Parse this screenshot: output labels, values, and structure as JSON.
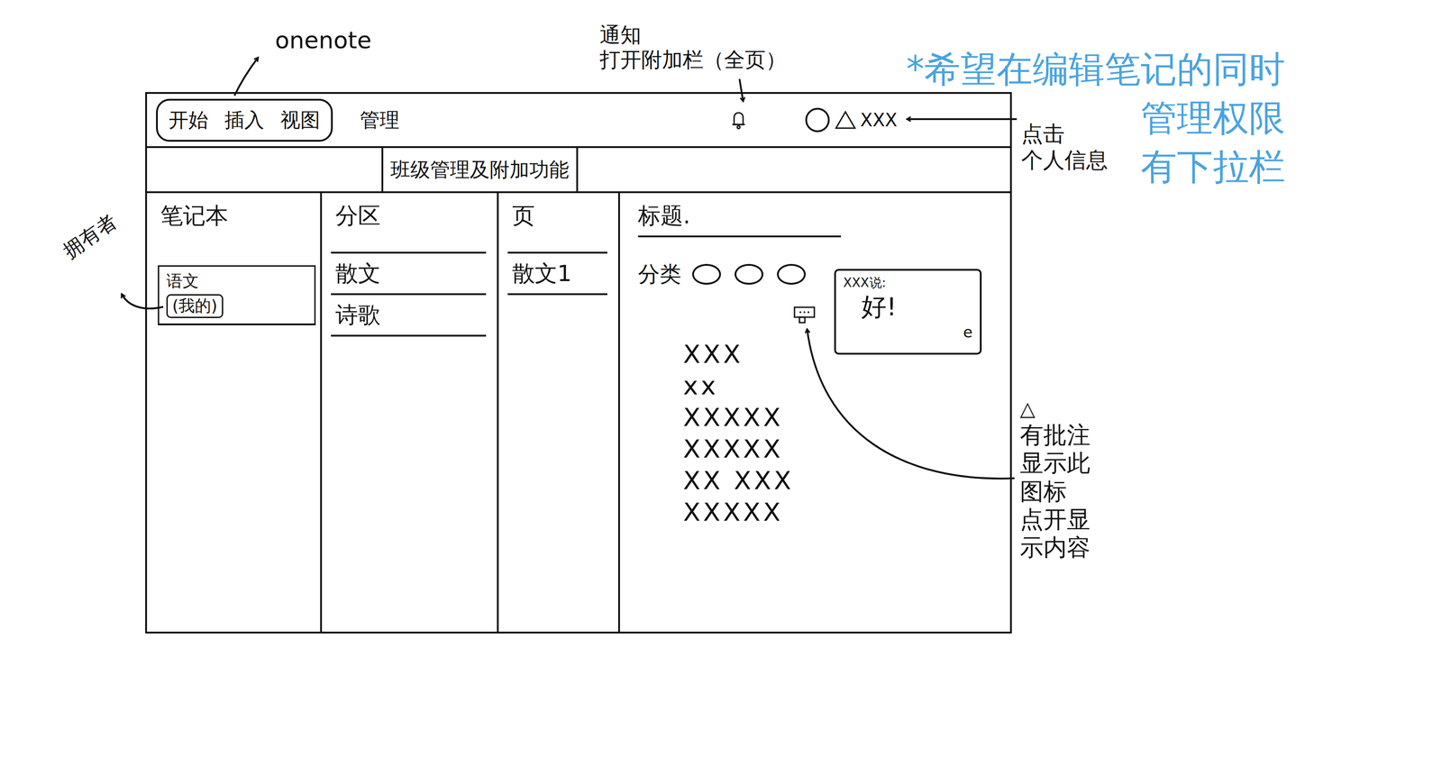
{
  "app_label": "onenote",
  "menu": [
    {
      "label": "开始",
      "grouped": true
    },
    {
      "label": "插入",
      "grouped": true
    },
    {
      "label": "视图",
      "grouped": true
    },
    {
      "label": "管理",
      "grouped": false
    }
  ],
  "sub_bar": "班级管理及附加功能",
  "notification_note": {
    "title": "通知",
    "text": "打开附加栏（全页）"
  },
  "user": {
    "name": "XXX"
  },
  "user_note": [
    "点击",
    "个人信息"
  ],
  "wish_note": [
    "*希望在编辑笔记的同时",
    "管理权限",
    "有下拉栏"
  ],
  "columns": [
    "笔记本",
    "分区",
    "页",
    "标题."
  ],
  "notebooks": [
    {
      "name": "语文",
      "owner": "(我的)"
    }
  ],
  "owner_note": "拥有者",
  "sections": [
    {
      "label": "散文"
    },
    {
      "label": "诗歌"
    }
  ],
  "pages": [
    {
      "label": "散文1"
    }
  ],
  "category_label": "分类",
  "categories": [
    {
      "filled": false
    },
    {
      "filled": false
    },
    {
      "filled": false
    }
  ],
  "comment": {
    "author": "XXX说:",
    "text": "好!",
    "icon": "e"
  },
  "content_lines": [
    "XXX",
    "xx",
    "XXXXX",
    "XXXXX",
    "XX XXX",
    "XXXXX"
  ],
  "comment_note": {
    "icon": "△",
    "lines": [
      "有批注",
      "显示此",
      "图标",
      "点开显",
      "示内容"
    ]
  }
}
